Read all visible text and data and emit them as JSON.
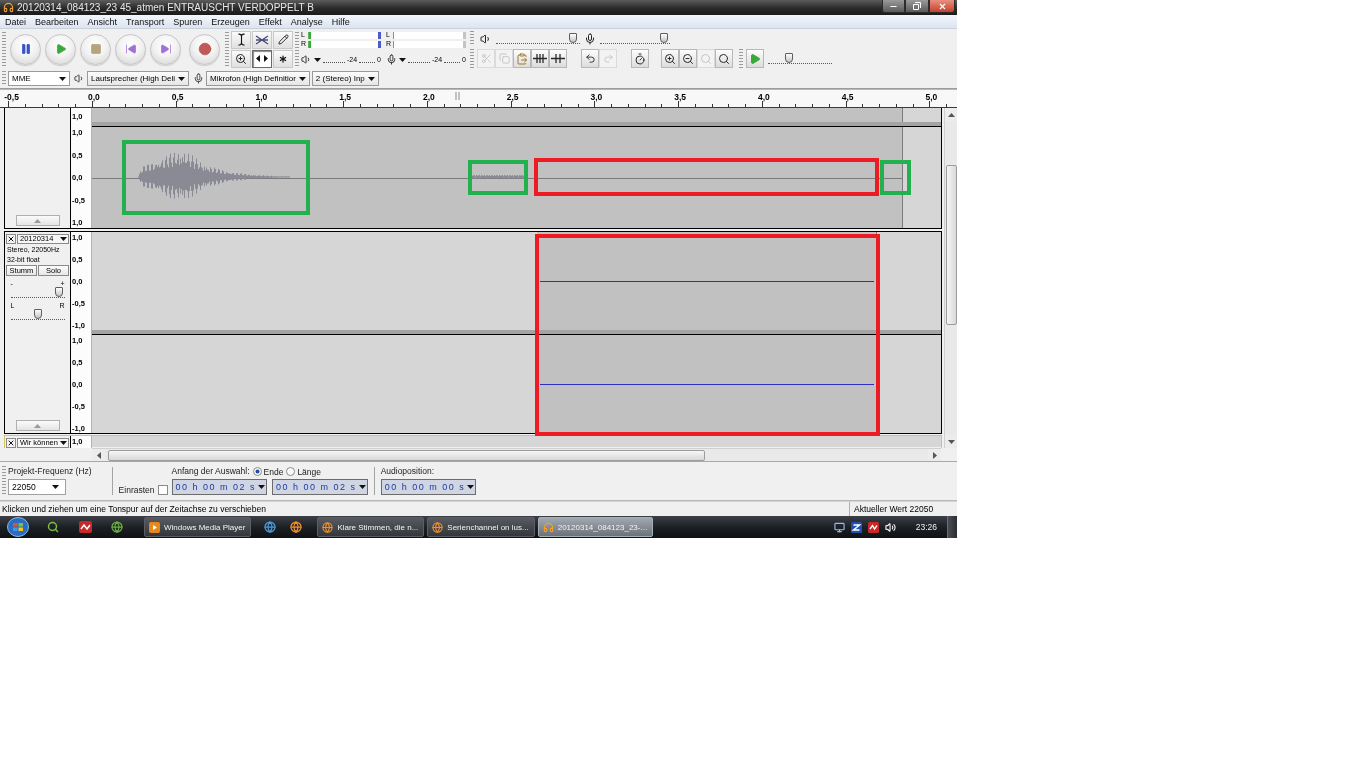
{
  "window": {
    "title": "20120314_084123_23 45_atmen ENTRAUSCHT VERDOPPELT B"
  },
  "menu": [
    "Datei",
    "Bearbeiten",
    "Ansicht",
    "Transport",
    "Spuren",
    "Erzeugen",
    "Effekt",
    "Analyse",
    "Hilfe"
  ],
  "tools": [
    {
      "selected": false
    },
    {
      "selected": false
    },
    {
      "selected": false
    },
    {
      "selected": false
    },
    {
      "selected": true
    },
    {
      "selected": false
    }
  ],
  "meters": [
    {
      "kind": "playback",
      "channels": [
        {
          "label": "L",
          "level": 0.03
        },
        {
          "label": "R",
          "level": 0.03
        }
      ],
      "scale": [
        "-24",
        "0"
      ]
    },
    {
      "kind": "recording",
      "channels": [
        {
          "label": "L"
        },
        {
          "label": "R"
        }
      ],
      "scale": [
        "-24",
        "0"
      ]
    }
  ],
  "mixer": [
    {
      "kind": "output",
      "level": 0.96
    },
    {
      "kind": "input",
      "level": 0.96
    }
  ],
  "edit_buttons": [
    {
      "disabled": true
    },
    {
      "disabled": true
    },
    {
      "disabled": false
    },
    {
      "disabled": false
    },
    {
      "disabled": false
    },
    {
      "disabled": false
    },
    {
      "disabled": true
    },
    {
      "disabled": false
    },
    {
      "disabled": false
    },
    {
      "disabled": false
    },
    {
      "disabled": true
    },
    {
      "disabled": false
    }
  ],
  "play_at_speed": {
    "level": 0.3
  },
  "devices": [
    {
      "kind": "host",
      "value": "MME"
    },
    {
      "kind": "output",
      "value": "Lautsprecher (High Deli"
    },
    {
      "kind": "input",
      "value": "Mikrofon (High Definitior"
    },
    {
      "kind": "channels",
      "value": "2 (Stereo) Inp"
    }
  ],
  "ruler": {
    "labels": [
      "-0,5",
      "0,0",
      "0,5",
      "1,0",
      "1,5",
      "2,0",
      "2,5",
      "3,0",
      "3,5",
      "4,0",
      "4,5",
      "5,0"
    ]
  },
  "tracks": [
    {
      "kind": "partial",
      "focused": false,
      "channels": [
        {
          "kind": "cut_top",
          "scale": [
            "1,0"
          ]
        },
        {
          "kind": "speech",
          "scale": [
            "1,0",
            "0,5",
            "0,0",
            "-0,5",
            "1,0"
          ]
        }
      ]
    },
    {
      "kind": "full",
      "focused": false,
      "name": "20120314",
      "info": [
        "Stereo, 22050Hz",
        "32-bit float"
      ],
      "buttons": [
        {
          "label": "Stumm",
          "pressed": false
        },
        {
          "label": "Solo",
          "pressed": false
        }
      ],
      "gain": {
        "min_label": "-",
        "max_label": "+",
        "level": 0.97
      },
      "pan": {
        "min_label": "L",
        "max_label": "R",
        "level": 0.5
      },
      "channels": [
        {
          "kind": "flat",
          "scale": [
            "1,0",
            "0,5",
            "0,0",
            "-0,5",
            "-1,0"
          ]
        },
        {
          "kind": "flat",
          "scale": [
            "1,0",
            "0,5",
            "0,0",
            "-0,5",
            "-1,0"
          ]
        }
      ]
    },
    {
      "kind": "peek",
      "focused": true,
      "name": "Wir können",
      "channels": [
        {
          "kind": "cut_bottom",
          "scale": [
            "1,0"
          ]
        }
      ]
    }
  ],
  "annotations": [
    {
      "color": "#22b14c"
    },
    {
      "color": "#22b14c"
    },
    {
      "color": "#ed1c24"
    },
    {
      "color": "#22b14c"
    },
    {
      "color": "#ed1c24"
    }
  ],
  "selection_toolbar": {
    "rate_label": "Projekt-Frequenz (Hz)",
    "rate": "22050",
    "snap": {
      "label": "Einrasten",
      "checked": false
    },
    "start_label": "Anfang der Auswahl:",
    "end_mode": [
      {
        "label": "Ende",
        "selected": true
      },
      {
        "label": "Länge",
        "selected": false
      }
    ],
    "times": [
      "00 h 00 m 02 s",
      "00 h 00 m 02 s"
    ],
    "position_label": "Audioposition:",
    "position": "00 h 00 m 00 s"
  },
  "status_bar": {
    "message": "Klicken und ziehen um eine Tonspur auf der Zeitachse zu verschieben",
    "value": "Aktueller Wert 22050"
  },
  "taskbar": {
    "buttons": [
      {
        "label": "Windows Media Player",
        "selected": false
      },
      {
        "label": "Klare Stimmen, die n...",
        "selected": false
      },
      {
        "label": "Serienchannel on lus...",
        "selected": false
      },
      {
        "label": "20120314_084123_23-...",
        "selected": true
      }
    ],
    "clock": "23:26"
  }
}
